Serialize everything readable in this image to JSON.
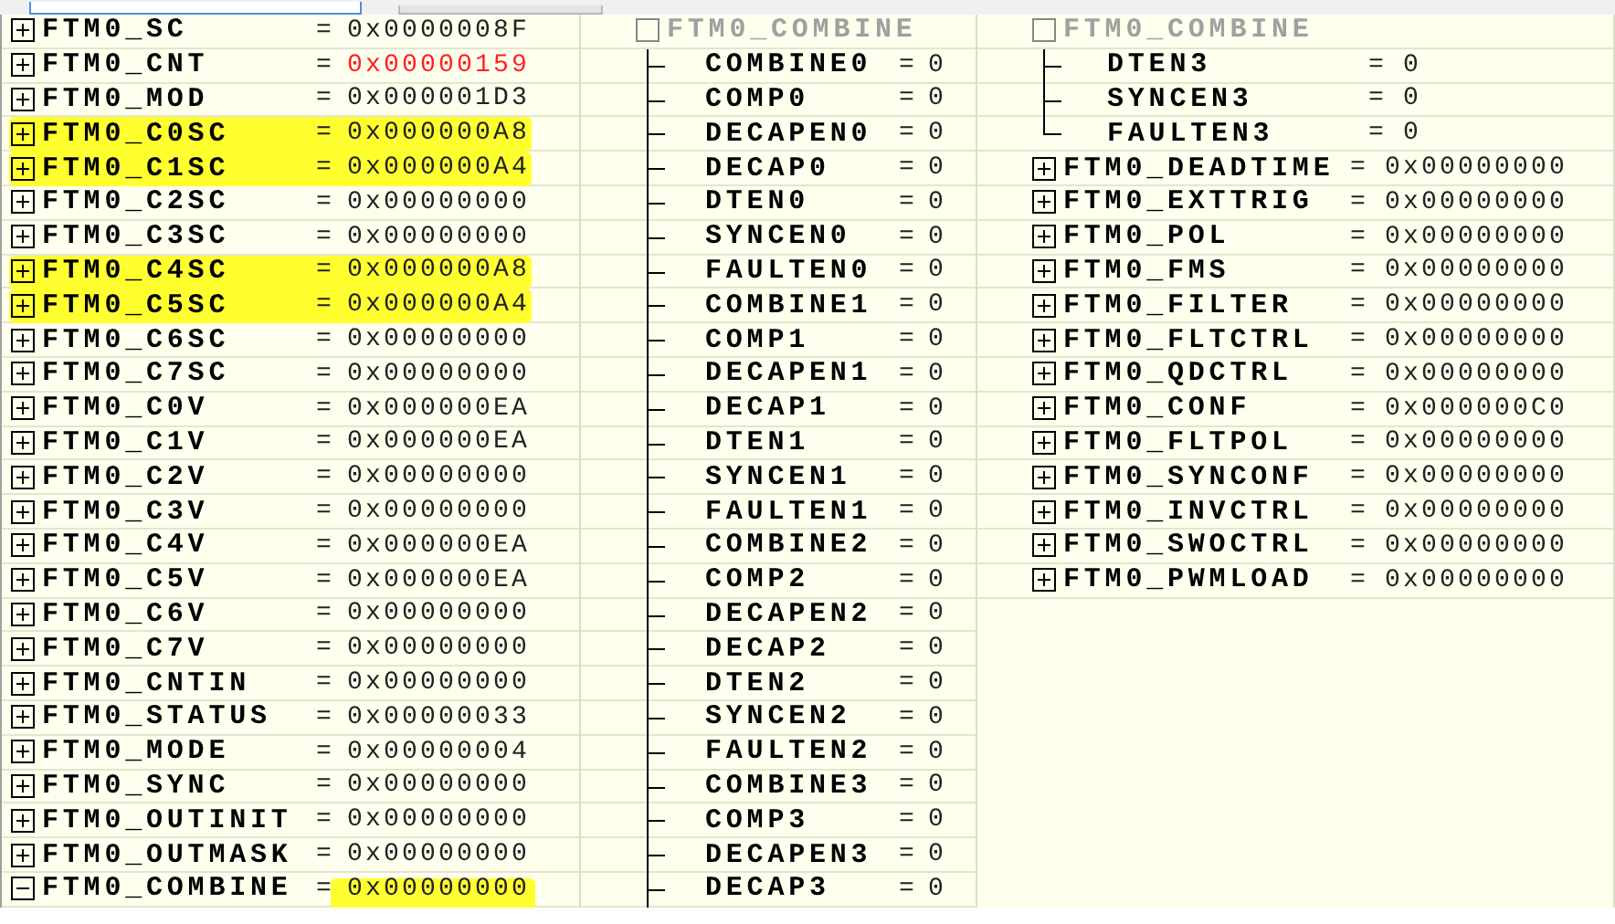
{
  "columns": [
    {
      "rows": [
        {
          "kind": "register",
          "name": "FTM0_SC",
          "sign": "=",
          "value": "0x0000008F",
          "expanded": false,
          "changed": false,
          "highlighted": false,
          "value_highlighted": false
        },
        {
          "kind": "register",
          "name": "FTM0_CNT",
          "sign": "=",
          "value": "0x00000159",
          "expanded": false,
          "changed": true,
          "highlighted": false,
          "value_highlighted": false
        },
        {
          "kind": "register",
          "name": "FTM0_MOD",
          "sign": "=",
          "value": "0x000001D3",
          "expanded": false,
          "changed": false,
          "highlighted": false,
          "value_highlighted": false
        },
        {
          "kind": "register",
          "name": "FTM0_C0SC",
          "sign": "=",
          "value": "0x000000A8",
          "expanded": false,
          "changed": false,
          "highlighted": true,
          "value_highlighted": false
        },
        {
          "kind": "register",
          "name": "FTM0_C1SC",
          "sign": "=",
          "value": "0x000000A4",
          "expanded": false,
          "changed": false,
          "highlighted": true,
          "value_highlighted": false
        },
        {
          "kind": "register",
          "name": "FTM0_C2SC",
          "sign": "=",
          "value": "0x00000000",
          "expanded": false,
          "changed": false,
          "highlighted": false,
          "value_highlighted": false
        },
        {
          "kind": "register",
          "name": "FTM0_C3SC",
          "sign": "=",
          "value": "0x00000000",
          "expanded": false,
          "changed": false,
          "highlighted": false,
          "value_highlighted": false
        },
        {
          "kind": "register",
          "name": "FTM0_C4SC",
          "sign": "=",
          "value": "0x000000A8",
          "expanded": false,
          "changed": false,
          "highlighted": true,
          "value_highlighted": false
        },
        {
          "kind": "register",
          "name": "FTM0_C5SC",
          "sign": "=",
          "value": "0x000000A4",
          "expanded": false,
          "changed": false,
          "highlighted": true,
          "value_highlighted": false
        },
        {
          "kind": "register",
          "name": "FTM0_C6SC",
          "sign": "=",
          "value": "0x00000000",
          "expanded": false,
          "changed": false,
          "highlighted": false,
          "value_highlighted": false
        },
        {
          "kind": "register",
          "name": "FTM0_C7SC",
          "sign": "=",
          "value": "0x00000000",
          "expanded": false,
          "changed": false,
          "highlighted": false,
          "value_highlighted": false
        },
        {
          "kind": "register",
          "name": "FTM0_C0V",
          "sign": "=",
          "value": "0x000000EA",
          "expanded": false,
          "changed": false,
          "highlighted": false,
          "value_highlighted": false
        },
        {
          "kind": "register",
          "name": "FTM0_C1V",
          "sign": "=",
          "value": "0x000000EA",
          "expanded": false,
          "changed": false,
          "highlighted": false,
          "value_highlighted": false
        },
        {
          "kind": "register",
          "name": "FTM0_C2V",
          "sign": "=",
          "value": "0x00000000",
          "expanded": false,
          "changed": false,
          "highlighted": false,
          "value_highlighted": false
        },
        {
          "kind": "register",
          "name": "FTM0_C3V",
          "sign": "=",
          "value": "0x00000000",
          "expanded": false,
          "changed": false,
          "highlighted": false,
          "value_highlighted": false
        },
        {
          "kind": "register",
          "name": "FTM0_C4V",
          "sign": "=",
          "value": "0x000000EA",
          "expanded": false,
          "changed": false,
          "highlighted": false,
          "value_highlighted": false
        },
        {
          "kind": "register",
          "name": "FTM0_C5V",
          "sign": "=",
          "value": "0x000000EA",
          "expanded": false,
          "changed": false,
          "highlighted": false,
          "value_highlighted": false
        },
        {
          "kind": "register",
          "name": "FTM0_C6V",
          "sign": "=",
          "value": "0x00000000",
          "expanded": false,
          "changed": false,
          "highlighted": false,
          "value_highlighted": false
        },
        {
          "kind": "register",
          "name": "FTM0_C7V",
          "sign": "=",
          "value": "0x00000000",
          "expanded": false,
          "changed": false,
          "highlighted": false,
          "value_highlighted": false
        },
        {
          "kind": "register",
          "name": "FTM0_CNTIN",
          "sign": "=",
          "value": "0x00000000",
          "expanded": false,
          "changed": false,
          "highlighted": false,
          "value_highlighted": false
        },
        {
          "kind": "register",
          "name": "FTM0_STATUS",
          "sign": "=",
          "value": "0x00000033",
          "expanded": false,
          "changed": false,
          "highlighted": false,
          "value_highlighted": false
        },
        {
          "kind": "register",
          "name": "FTM0_MODE",
          "sign": "=",
          "value": "0x00000004",
          "expanded": false,
          "changed": false,
          "highlighted": false,
          "value_highlighted": false
        },
        {
          "kind": "register",
          "name": "FTM0_SYNC",
          "sign": "=",
          "value": "0x00000000",
          "expanded": false,
          "changed": false,
          "highlighted": false,
          "value_highlighted": false
        },
        {
          "kind": "register",
          "name": "FTM0_OUTINIT",
          "sign": "=",
          "value": "0x00000000",
          "expanded": false,
          "changed": false,
          "highlighted": false,
          "value_highlighted": false
        },
        {
          "kind": "register",
          "name": "FTM0_OUTMASK",
          "sign": "=",
          "value": "0x00000000",
          "expanded": false,
          "changed": false,
          "highlighted": false,
          "value_highlighted": false
        },
        {
          "kind": "register",
          "name": "FTM0_COMBINE",
          "sign": "=",
          "value": "0x00000000",
          "expanded": true,
          "changed": false,
          "highlighted": false,
          "value_highlighted": true
        }
      ]
    },
    {
      "rows": [
        {
          "kind": "group",
          "name": "FTM0_COMBINE"
        },
        {
          "kind": "field",
          "name": "COMBINE0",
          "sign": "=",
          "value": "0",
          "last": false
        },
        {
          "kind": "field",
          "name": "COMP0",
          "sign": "=",
          "value": "0",
          "last": false
        },
        {
          "kind": "field",
          "name": "DECAPEN0",
          "sign": "=",
          "value": "0",
          "last": false
        },
        {
          "kind": "field",
          "name": "DECAP0",
          "sign": "=",
          "value": "0",
          "last": false
        },
        {
          "kind": "field",
          "name": "DTEN0",
          "sign": "=",
          "value": "0",
          "last": false
        },
        {
          "kind": "field",
          "name": "SYNCEN0",
          "sign": "=",
          "value": "0",
          "last": false
        },
        {
          "kind": "field",
          "name": "FAULTEN0",
          "sign": "=",
          "value": "0",
          "last": false
        },
        {
          "kind": "field",
          "name": "COMBINE1",
          "sign": "=",
          "value": "0",
          "last": false
        },
        {
          "kind": "field",
          "name": "COMP1",
          "sign": "=",
          "value": "0",
          "last": false
        },
        {
          "kind": "field",
          "name": "DECAPEN1",
          "sign": "=",
          "value": "0",
          "last": false
        },
        {
          "kind": "field",
          "name": "DECAP1",
          "sign": "=",
          "value": "0",
          "last": false
        },
        {
          "kind": "field",
          "name": "DTEN1",
          "sign": "=",
          "value": "0",
          "last": false
        },
        {
          "kind": "field",
          "name": "SYNCEN1",
          "sign": "=",
          "value": "0",
          "last": false
        },
        {
          "kind": "field",
          "name": "FAULTEN1",
          "sign": "=",
          "value": "0",
          "last": false
        },
        {
          "kind": "field",
          "name": "COMBINE2",
          "sign": "=",
          "value": "0",
          "last": false
        },
        {
          "kind": "field",
          "name": "COMP2",
          "sign": "=",
          "value": "0",
          "last": false
        },
        {
          "kind": "field",
          "name": "DECAPEN2",
          "sign": "=",
          "value": "0",
          "last": false
        },
        {
          "kind": "field",
          "name": "DECAP2",
          "sign": "=",
          "value": "0",
          "last": false
        },
        {
          "kind": "field",
          "name": "DTEN2",
          "sign": "=",
          "value": "0",
          "last": false
        },
        {
          "kind": "field",
          "name": "SYNCEN2",
          "sign": "=",
          "value": "0",
          "last": false
        },
        {
          "kind": "field",
          "name": "FAULTEN2",
          "sign": "=",
          "value": "0",
          "last": false
        },
        {
          "kind": "field",
          "name": "COMBINE3",
          "sign": "=",
          "value": "0",
          "last": false
        },
        {
          "kind": "field",
          "name": "COMP3",
          "sign": "=",
          "value": "0",
          "last": false
        },
        {
          "kind": "field",
          "name": "DECAPEN3",
          "sign": "=",
          "value": "0",
          "last": false
        },
        {
          "kind": "field",
          "name": "DECAP3",
          "sign": "=",
          "value": "0",
          "last": false
        }
      ]
    },
    {
      "rows": [
        {
          "kind": "group",
          "name": "FTM0_COMBINE"
        },
        {
          "kind": "field",
          "name": "DTEN3",
          "sign": "=",
          "value": "0",
          "last": false
        },
        {
          "kind": "field",
          "name": "SYNCEN3",
          "sign": "=",
          "value": "0",
          "last": false
        },
        {
          "kind": "field",
          "name": "FAULTEN3",
          "sign": "=",
          "value": "0",
          "last": true
        },
        {
          "kind": "register",
          "name": "FTM0_DEADTIME",
          "sign": "=",
          "value": "0x00000000",
          "expanded": false,
          "changed": false,
          "highlighted": false,
          "value_highlighted": false
        },
        {
          "kind": "register",
          "name": "FTM0_EXTTRIG",
          "sign": "=",
          "value": "0x00000000",
          "expanded": false,
          "changed": false,
          "highlighted": false,
          "value_highlighted": false
        },
        {
          "kind": "register",
          "name": "FTM0_POL",
          "sign": "=",
          "value": "0x00000000",
          "expanded": false,
          "changed": false,
          "highlighted": false,
          "value_highlighted": false
        },
        {
          "kind": "register",
          "name": "FTM0_FMS",
          "sign": "=",
          "value": "0x00000000",
          "expanded": false,
          "changed": false,
          "highlighted": false,
          "value_highlighted": false
        },
        {
          "kind": "register",
          "name": "FTM0_FILTER",
          "sign": "=",
          "value": "0x00000000",
          "expanded": false,
          "changed": false,
          "highlighted": false,
          "value_highlighted": false
        },
        {
          "kind": "register",
          "name": "FTM0_FLTCTRL",
          "sign": "=",
          "value": "0x00000000",
          "expanded": false,
          "changed": false,
          "highlighted": false,
          "value_highlighted": false
        },
        {
          "kind": "register",
          "name": "FTM0_QDCTRL",
          "sign": "=",
          "value": "0x00000000",
          "expanded": false,
          "changed": false,
          "highlighted": false,
          "value_highlighted": false
        },
        {
          "kind": "register",
          "name": "FTM0_CONF",
          "sign": "=",
          "value": "0x000000C0",
          "expanded": false,
          "changed": false,
          "highlighted": false,
          "value_highlighted": false
        },
        {
          "kind": "register",
          "name": "FTM0_FLTPOL",
          "sign": "=",
          "value": "0x00000000",
          "expanded": false,
          "changed": false,
          "highlighted": false,
          "value_highlighted": false
        },
        {
          "kind": "register",
          "name": "FTM0_SYNCONF",
          "sign": "=",
          "value": "0x00000000",
          "expanded": false,
          "changed": false,
          "highlighted": false,
          "value_highlighted": false
        },
        {
          "kind": "register",
          "name": "FTM0_INVCTRL",
          "sign": "=",
          "value": "0x00000000",
          "expanded": false,
          "changed": false,
          "highlighted": false,
          "value_highlighted": false
        },
        {
          "kind": "register",
          "name": "FTM0_SWOCTRL",
          "sign": "=",
          "value": "0x00000000",
          "expanded": false,
          "changed": false,
          "highlighted": false,
          "value_highlighted": false
        },
        {
          "kind": "register",
          "name": "FTM0_PWMLOAD",
          "sign": "=",
          "value": "0x00000000",
          "expanded": false,
          "changed": false,
          "highlighted": false,
          "value_highlighted": false
        }
      ]
    }
  ]
}
